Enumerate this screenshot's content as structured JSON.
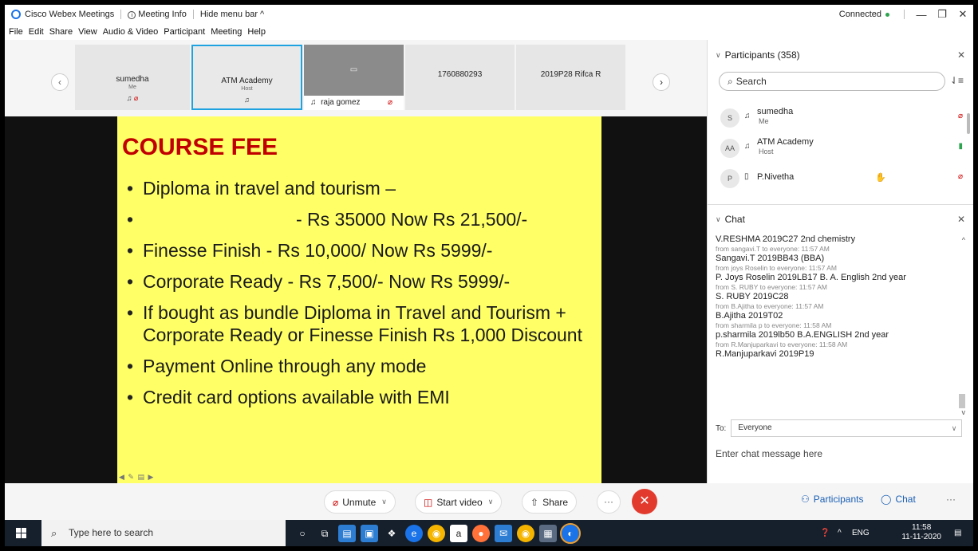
{
  "titlebar": {
    "app_name": "Cisco Webex Meetings",
    "meeting_info": "Meeting Info",
    "hide_menu": "Hide menu bar ^",
    "status": "Connected",
    "min": "—",
    "restore": "❐",
    "close": "✕",
    "colors": {
      "connected_dot": "#2ea44f"
    }
  },
  "menu": {
    "items": [
      "File",
      "Edit",
      "Share",
      "View",
      "Audio & Video",
      "Participant",
      "Meeting",
      "Help"
    ]
  },
  "thumbnails": {
    "prev": "‹",
    "next": "›",
    "items": [
      {
        "name": "sumedha",
        "role": "Me"
      },
      {
        "name": "ATM Academy",
        "role": "Host"
      },
      {
        "name": "raja gomez",
        "role": ""
      },
      {
        "name": "1760880293",
        "role": ""
      },
      {
        "name": "2019P28 Rifca R",
        "role": ""
      }
    ]
  },
  "slide": {
    "title": "COURSE FEE",
    "bullets": [
      "Diploma in travel and tourism –",
      "- Rs 35000  Now Rs 21,500/-",
      "Finesse Finish  -  Rs 10,000/  Now Rs 5999/-",
      "Corporate Ready - Rs 7,500/- Now Rs 5999/-",
      "If bought as bundle Diploma in Travel and Tourism + Corporate Ready or Finesse Finish Rs 1,000 Discount",
      "Payment Online through any mode",
      "Credit card options available with EMI"
    ],
    "colors": {
      "background": "#ffff66",
      "title": "#c00000"
    }
  },
  "controls": {
    "unmute": "Unmute",
    "start_video": "Start video",
    "share": "Share",
    "more": "···",
    "end": "✕",
    "participants": "Participants",
    "chat": "Chat",
    "right_more": "···"
  },
  "participants_panel": {
    "title": "Participants (358)",
    "search_placeholder": "Search",
    "people": [
      {
        "initials": "S",
        "name": "sumedha",
        "role": "Me"
      },
      {
        "initials": "AA",
        "name": "ATM Academy",
        "role": "Host"
      },
      {
        "initials": "P",
        "name": "P.Nivetha",
        "role": ""
      }
    ]
  },
  "chat_panel": {
    "title": "Chat",
    "messages": [
      {
        "text": "V.RESHMA 2019C27 2nd chemistry",
        "from": "from sangavi.T to everyone:   11:57 AM"
      },
      {
        "text": "Sangavi.T 2019BB43 (BBA)",
        "from": "from joys Roselin to everyone:   11:57 AM"
      },
      {
        "text": "P. Joys Roselin 2019LB17 B. A. English 2nd year",
        "from": "from S. RUBY to everyone:   11:57 AM"
      },
      {
        "text": "S. RUBY 2019C28",
        "from": "from B.Ajitha to everyone:   11:57 AM"
      },
      {
        "text": "B.Ajitha 2019T02",
        "from": "from sharmila p to everyone:   11:58 AM"
      },
      {
        "text": "p.sharmila 2019lb50 B.A.ENGLISH 2nd year",
        "from": "from R.Manjuparkavi to everyone:   11:58 AM"
      },
      {
        "text": "R.Manjuparkavi 2019P19",
        "from": ""
      }
    ],
    "to_label": "To:",
    "to_value": "Everyone",
    "input_placeholder": "Enter chat message here"
  },
  "taskbar": {
    "search_placeholder": "Type here to search",
    "lang": "ENG",
    "time": "11:58",
    "date": "11-11-2020"
  }
}
